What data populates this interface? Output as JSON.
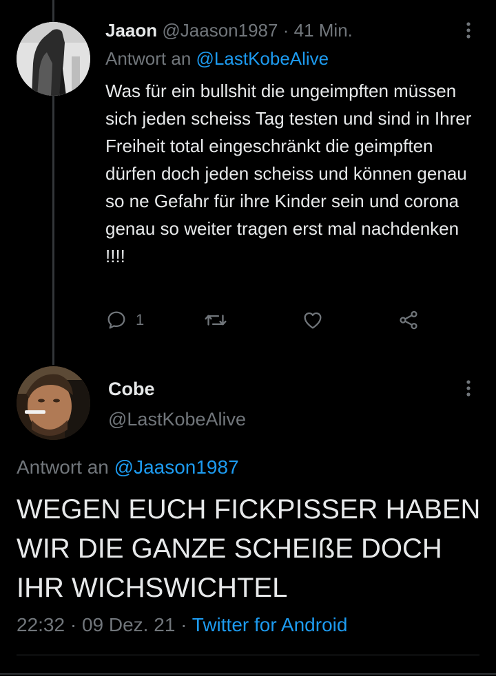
{
  "tweet1": {
    "author_name": "Jaaon",
    "author_handle": "@Jaason1987",
    "separator": "·",
    "time": "41 Min.",
    "reply_prefix": "Antwort an",
    "reply_to": "@LastKobeAlive",
    "text": "Was für ein bullshit die ungeimpften müssen sich jeden scheiss Tag testen und sind in Ihrer Freiheit total eingeschränkt die geimpften dürfen doch jeden scheiss und können genau so ne Gefahr für ihre Kinder sein und corona genau so weiter tragen erst mal nachdenken !!!!",
    "actions": {
      "reply_count": "1",
      "reply_icon": "reply-icon",
      "retweet_icon": "retweet-icon",
      "like_icon": "like-icon",
      "share_icon": "share-icon"
    }
  },
  "tweet2": {
    "author_name": "Cobe",
    "author_handle": "@LastKobeAlive",
    "reply_prefix": "Antwort an",
    "reply_to": "@Jaason1987",
    "text": "WEGEN EUCH FICKPISSER HABEN WIR DIE GANZE SCHEIßE DOCH IHR WICHSWICHTEL",
    "time": "22:32",
    "sep1": "·",
    "date": "09 Dez. 21",
    "sep2": "·",
    "source": "Twitter for Android"
  },
  "colors": {
    "background": "#000000",
    "text": "#e7e9ea",
    "muted": "#71767b",
    "link": "#1d9bf0"
  }
}
